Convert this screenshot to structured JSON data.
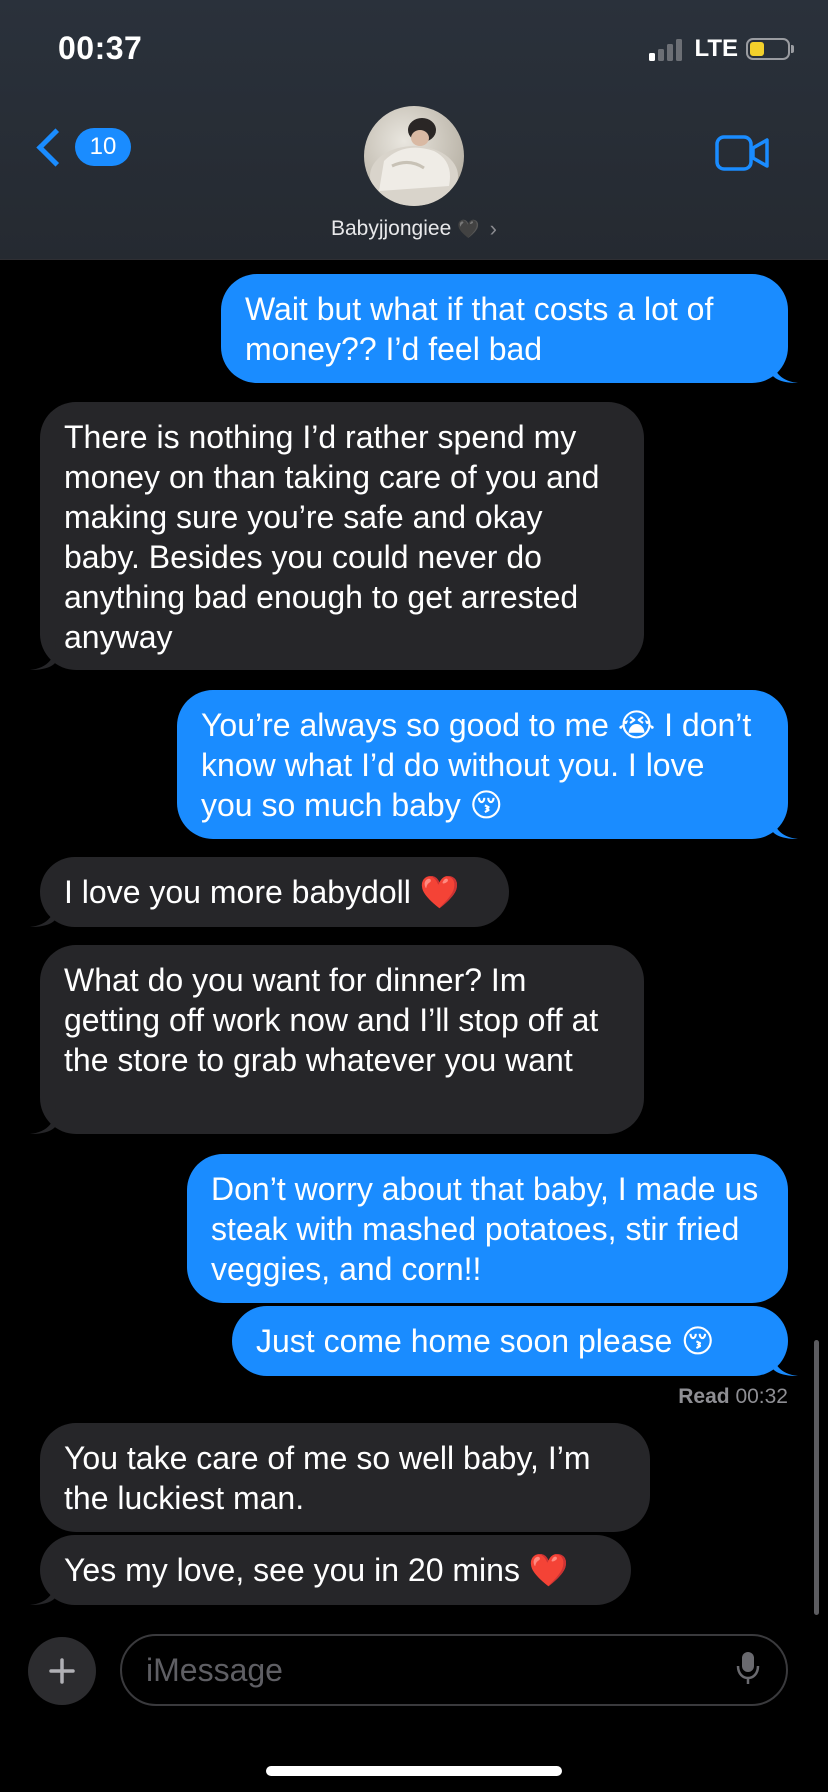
{
  "status_bar": {
    "time": "00:37",
    "network": "LTE",
    "battery_level": 0.4,
    "battery_color": "#f2d02b",
    "signal_bars_active": 1
  },
  "header": {
    "back_count": "10",
    "contact_name": "Babyjjongiee",
    "name_emoji": "🖤",
    "chevron": "›",
    "accent_color": "#1a8cff"
  },
  "messages": [
    {
      "sender": "me",
      "text": "Wait but what if that costs a lot of money?? I’d feel bad"
    },
    {
      "sender": "them",
      "text": "There is nothing I’d rather spend my money on than taking care of you and making sure you’re safe and okay baby. Besides you could never do anything bad enough to get arrested anyway"
    },
    {
      "sender": "me",
      "text": "You’re always so good to me 😭 I don’t know what I’d do without you. I love you so much baby 😚"
    },
    {
      "sender": "them",
      "text": "I love you more babydoll ❤️"
    },
    {
      "sender": "them",
      "text": "What do you want for dinner? Im getting off work now and I’ll stop off at the store to grab whatever you want"
    },
    {
      "sender": "me",
      "text": "Don’t worry about that baby, I made us steak with mashed potatoes, stir fried veggies, and corn!!"
    },
    {
      "sender": "me",
      "text": "Just come home soon please 😚"
    },
    {
      "sender": "them",
      "text": "You take care of me so well baby, I’m the luckiest man."
    },
    {
      "sender": "them",
      "text": "Yes my love, see you in 20 mins ❤️"
    }
  ],
  "read_receipt": {
    "label": "Read",
    "time": "00:32"
  },
  "composer": {
    "placeholder": "iMessage"
  },
  "colors": {
    "sent_bubble": "#1a8cff",
    "received_bubble": "#262629",
    "background": "#000000"
  }
}
